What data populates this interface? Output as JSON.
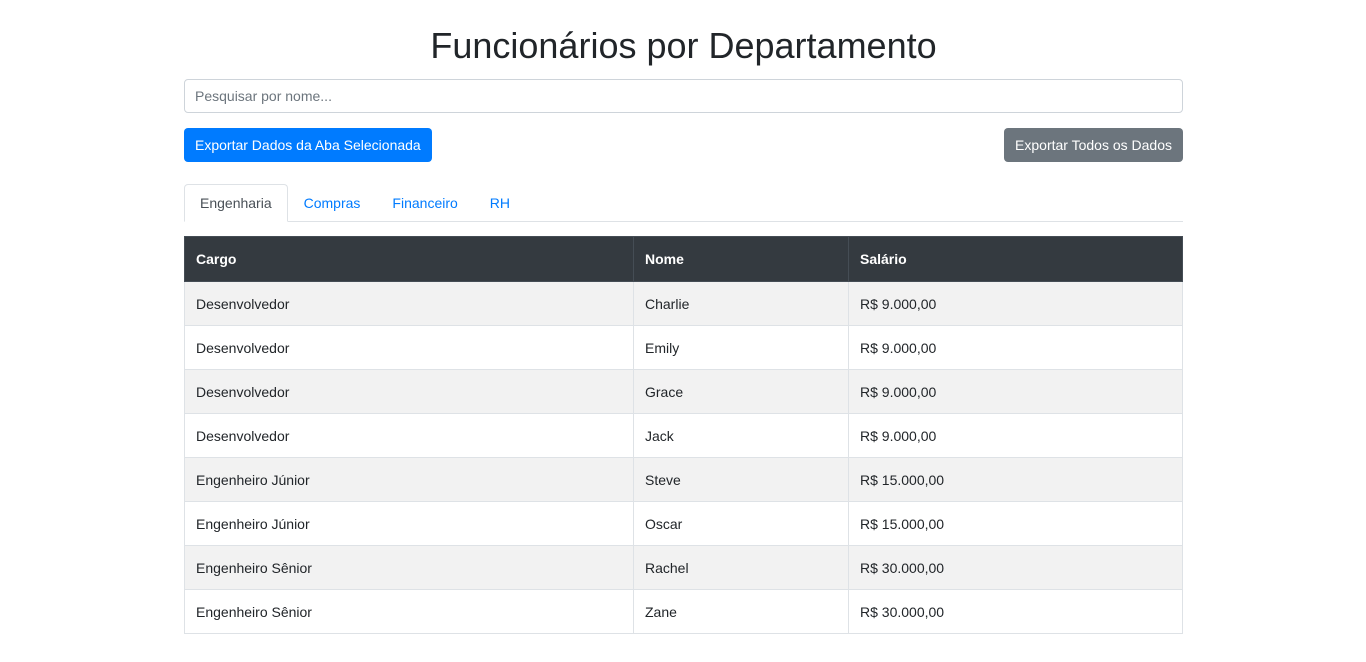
{
  "page": {
    "title": "Funcionários por Departamento"
  },
  "search": {
    "placeholder": "Pesquisar por nome...",
    "value": ""
  },
  "buttons": {
    "export_selected": "Exportar Dados da Aba Selecionada",
    "export_all": "Exportar Todos os Dados"
  },
  "tabs": [
    {
      "label": "Engenharia",
      "active": true
    },
    {
      "label": "Compras",
      "active": false
    },
    {
      "label": "Financeiro",
      "active": false
    },
    {
      "label": "RH",
      "active": false
    }
  ],
  "table": {
    "headers": [
      "Cargo",
      "Nome",
      "Salário"
    ],
    "rows": [
      [
        "Desenvolvedor",
        "Charlie",
        "R$ 9.000,00"
      ],
      [
        "Desenvolvedor",
        "Emily",
        "R$ 9.000,00"
      ],
      [
        "Desenvolvedor",
        "Grace",
        "R$ 9.000,00"
      ],
      [
        "Desenvolvedor",
        "Jack",
        "R$ 9.000,00"
      ],
      [
        "Engenheiro Júnior",
        "Steve",
        "R$ 15.000,00"
      ],
      [
        "Engenheiro Júnior",
        "Oscar",
        "R$ 15.000,00"
      ],
      [
        "Engenheiro Sênior",
        "Rachel",
        "R$ 30.000,00"
      ],
      [
        "Engenheiro Sênior",
        "Zane",
        "R$ 30.000,00"
      ]
    ]
  },
  "colors": {
    "primary": "#007bff",
    "secondary": "#6c757d",
    "table_header": "#343a40",
    "stripe": "#f2f2f2"
  }
}
